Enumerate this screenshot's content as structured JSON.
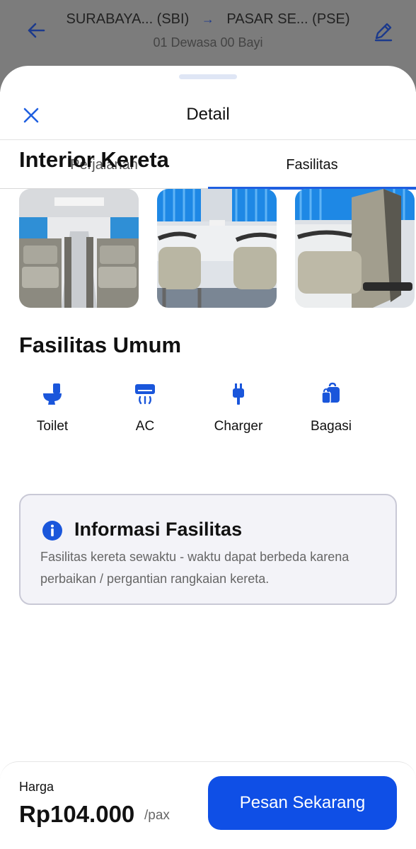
{
  "header": {
    "origin": "SURABAYA... (SBI)",
    "destination": "PASAR SE... (PSE)",
    "passengers": "01 Dewasa 00 Bayi"
  },
  "sheet": {
    "title": "Detail",
    "tabs": [
      {
        "label": "Perjalanan",
        "active": false
      },
      {
        "label": "Fasilitas",
        "active": true
      }
    ]
  },
  "interior": {
    "title": "Interior Kereta",
    "photos": [
      "train-interior-aisle",
      "train-seats-window-curtains",
      "train-seat-side-view"
    ]
  },
  "facilities": {
    "title": "Fasilitas Umum",
    "items": [
      {
        "label": "Toilet",
        "icon": "toilet-icon"
      },
      {
        "label": "AC",
        "icon": "ac-icon"
      },
      {
        "label": "Charger",
        "icon": "charger-icon"
      },
      {
        "label": "Bagasi",
        "icon": "luggage-icon"
      }
    ]
  },
  "info": {
    "title": "Informasi Fasilitas",
    "text": "Fasilitas kereta sewaktu - waktu dapat berbeda karena perbaikan / pergantian rangkaian kereta."
  },
  "footer": {
    "price_label": "Harga",
    "price_value": "Rp104.000",
    "price_unit": "/pax",
    "book_label": "Pesan Sekarang"
  },
  "colors": {
    "accent": "#1f5fe0",
    "button": "#0f4fe6",
    "icon_blue": "#1a56db",
    "overlay": "#7c7c7c"
  }
}
